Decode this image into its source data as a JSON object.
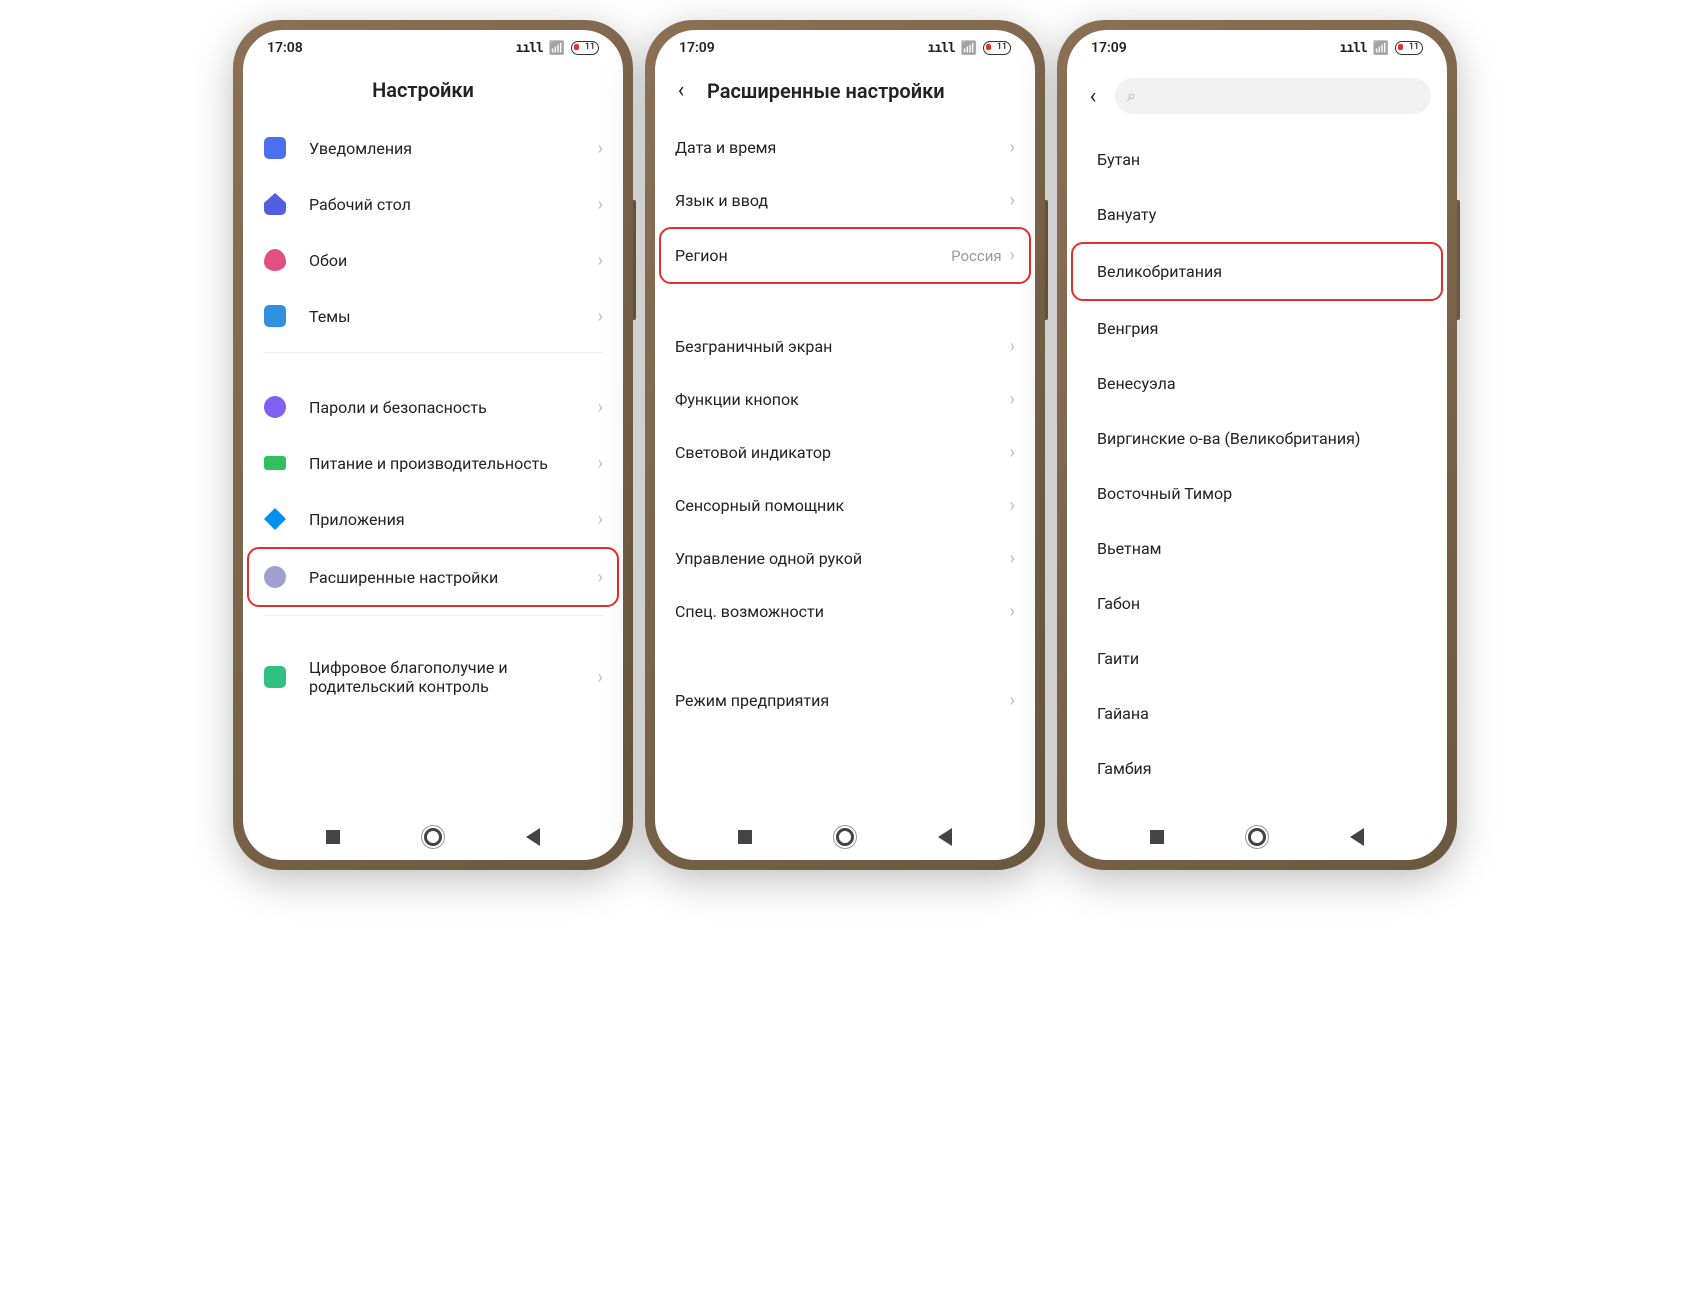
{
  "status": {
    "time1": "17:08",
    "time2": "17:09",
    "time3": "17:09",
    "battery": "11"
  },
  "screen1": {
    "title": "Настройки",
    "items": [
      {
        "label": "Уведомления",
        "icon": "ic-notif"
      },
      {
        "label": "Рабочий стол",
        "icon": "ic-home"
      },
      {
        "label": "Обои",
        "icon": "ic-wall"
      },
      {
        "label": "Темы",
        "icon": "ic-theme"
      }
    ],
    "items2": [
      {
        "label": "Пароли и безопасность",
        "icon": "ic-sec"
      },
      {
        "label": "Питание и производительность",
        "icon": "ic-bat"
      },
      {
        "label": "Приложения",
        "icon": "ic-app"
      },
      {
        "label": "Расширенные настройки",
        "icon": "ic-adv",
        "hl": true
      }
    ],
    "items3": [
      {
        "label": "Цифровое благополучие и родительский контроль",
        "icon": "ic-dig"
      }
    ]
  },
  "screen2": {
    "title": "Расширенные настройки",
    "items": [
      {
        "label": "Дата и время"
      },
      {
        "label": "Язык и ввод"
      },
      {
        "label": "Регион",
        "value": "Россия",
        "hl": true
      }
    ],
    "items2": [
      {
        "label": "Безграничный экран"
      },
      {
        "label": "Функции кнопок"
      },
      {
        "label": "Световой индикатор"
      },
      {
        "label": "Сенсорный помощник"
      },
      {
        "label": "Управление одной рукой"
      },
      {
        "label": "Спец. возможности"
      }
    ],
    "items3": [
      {
        "label": "Режим предприятия"
      }
    ]
  },
  "screen3": {
    "countries": [
      "Бутан",
      "Вануату",
      "Великобритания",
      "Венгрия",
      "Венесуэла",
      "Виргинские о-ва (Великобритания)",
      "Восточный Тимор",
      "Вьетнам",
      "Габон",
      "Гаити",
      "Гайана",
      "Гамбия"
    ],
    "highlight": "Великобритания"
  }
}
